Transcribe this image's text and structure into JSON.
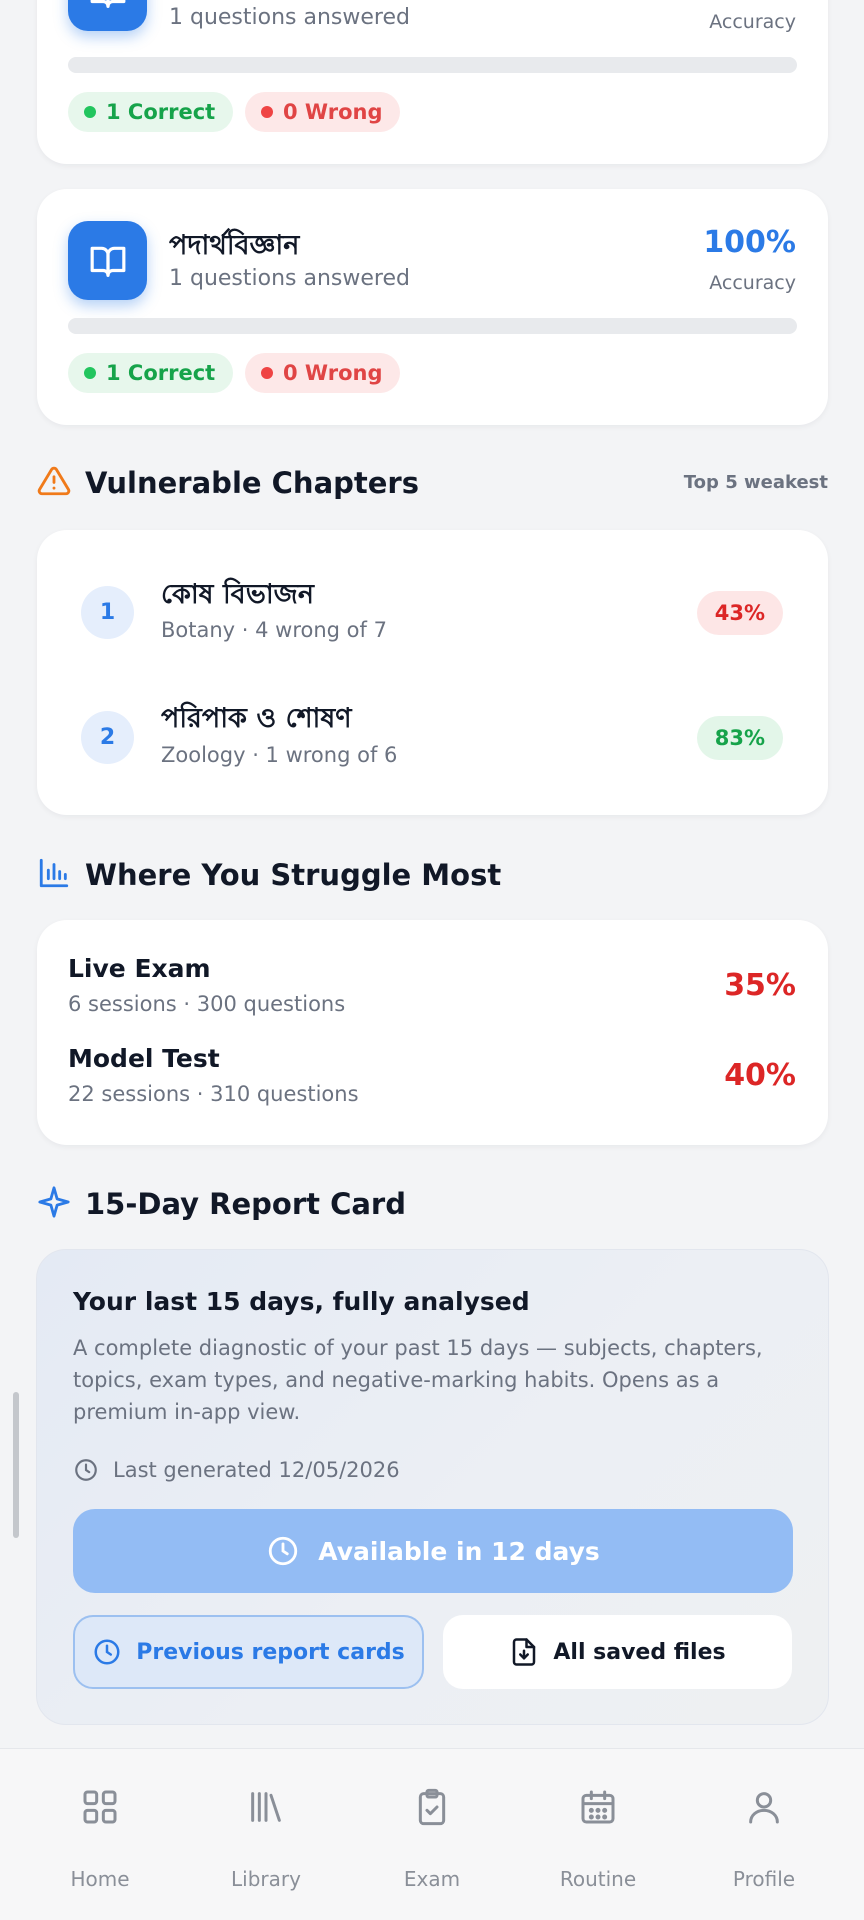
{
  "subjects": [
    {
      "title": "",
      "subtitle": "1 questions answered",
      "accuracy_label": "Accuracy",
      "correct": "1 Correct",
      "wrong": "0 Wrong"
    },
    {
      "title": "পদার্থবিজ্ঞান",
      "subtitle": "1 questions answered",
      "accuracy": "100%",
      "accuracy_label": "Accuracy",
      "correct": "1 Correct",
      "wrong": "0 Wrong"
    }
  ],
  "vulnerable": {
    "title": "Vulnerable Chapters",
    "note": "Top 5 weakest",
    "items": [
      {
        "rank": "1",
        "title": "কোষ বিভাজন",
        "subtitle": "Botany · 4 wrong of 7",
        "percent": "43%",
        "status": "bad"
      },
      {
        "rank": "2",
        "title": "পরিপাক ও শোষণ",
        "subtitle": "Zoology · 1 wrong of 6",
        "percent": "83%",
        "status": "good"
      }
    ]
  },
  "struggle": {
    "title": "Where You Struggle Most",
    "items": [
      {
        "title": "Live Exam",
        "subtitle": "6 sessions · 300 questions",
        "percent": "35%"
      },
      {
        "title": "Model Test",
        "subtitle": "22 sessions · 310 questions",
        "percent": "40%"
      }
    ]
  },
  "report": {
    "section_title": "15-Day Report Card",
    "card_title": "Your last 15 days, fully analysed",
    "description": "A complete diagnostic of your past 15 days — subjects, chapters, topics, exam types, and negative-marking habits. Opens as a premium in-app view.",
    "last_generated": "Last generated 12/05/2026",
    "available_button": "Available in 12 days",
    "previous_button": "Previous report cards",
    "saved_button": "All saved files"
  },
  "nav": {
    "items": [
      {
        "label": "Home",
        "icon": "grid-icon"
      },
      {
        "label": "Library",
        "icon": "library-icon"
      },
      {
        "label": "Exam",
        "icon": "clipboard-check-icon"
      },
      {
        "label": "Routine",
        "icon": "calendar-icon"
      },
      {
        "label": "Profile",
        "icon": "user-icon"
      }
    ]
  },
  "colors": {
    "accent": "#2b7ae6",
    "correct": "#16a34a",
    "wrong": "#e04545",
    "warning": "#f07a1a"
  }
}
